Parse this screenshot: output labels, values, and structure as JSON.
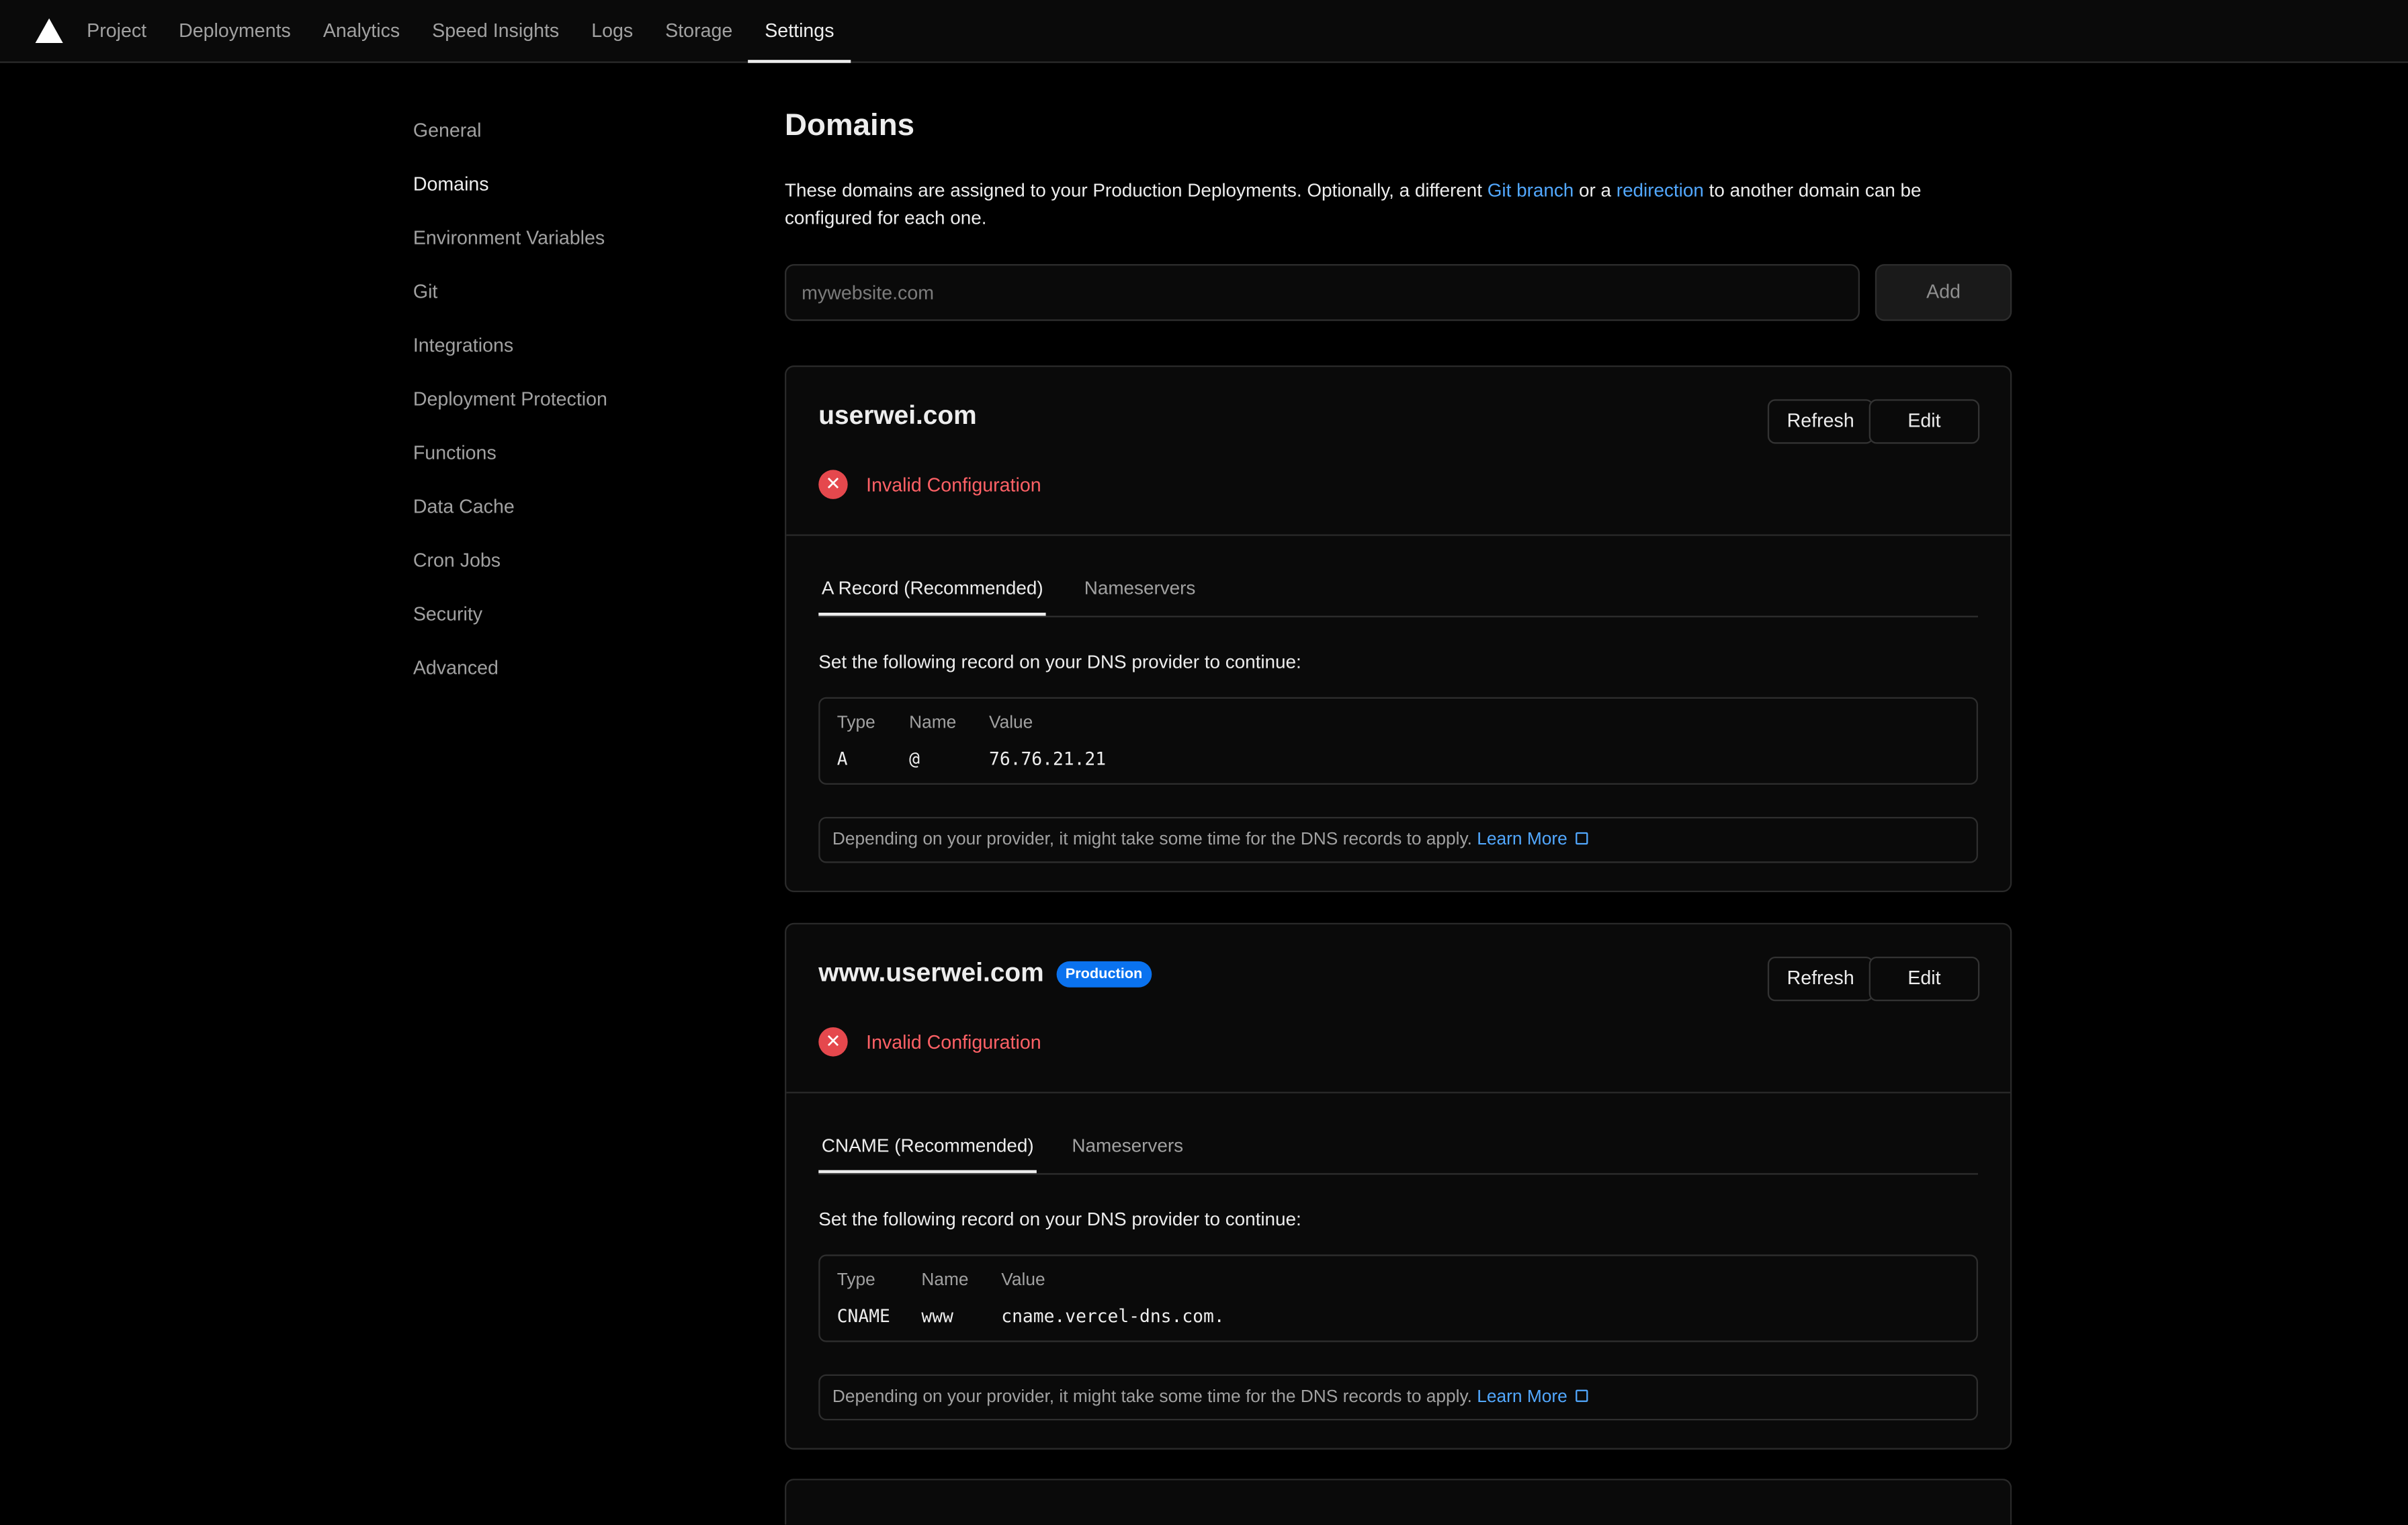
{
  "nav": {
    "tabs": [
      "Project",
      "Deployments",
      "Analytics",
      "Speed Insights",
      "Logs",
      "Storage",
      "Settings"
    ],
    "active": "Settings"
  },
  "sidebar": {
    "items": [
      "General",
      "Domains",
      "Environment Variables",
      "Git",
      "Integrations",
      "Deployment Protection",
      "Functions",
      "Data Cache",
      "Cron Jobs",
      "Security",
      "Advanced"
    ],
    "active": "Domains"
  },
  "main": {
    "title": "Domains",
    "description": {
      "part1": "These domains are assigned to your Production Deployments. Optionally, a different ",
      "link1": "Git branch",
      "part2": " or a ",
      "link2": "redirection",
      "part3": " to another domain can be configured for each one."
    },
    "input_placeholder": "mywebsite.com",
    "add_label": "Add"
  },
  "domains": [
    {
      "name": "userwei.com",
      "badge": "",
      "refresh_label": "Refresh",
      "edit_label": "Edit",
      "status": "Invalid Configuration",
      "tabs": [
        "A Record (Recommended)",
        "Nameservers"
      ],
      "instruction": "Set the following record on your DNS provider to continue:",
      "headers": [
        "Type",
        "Name",
        "Value"
      ],
      "record": [
        "A",
        "@",
        "76.76.21.21"
      ],
      "note": "Depending on your provider, it might take some time for the DNS records to apply.",
      "learn_more": "Learn More"
    },
    {
      "name": "www.userwei.com",
      "badge": "Production",
      "refresh_label": "Refresh",
      "edit_label": "Edit",
      "status": "Invalid Configuration",
      "tabs": [
        "CNAME (Recommended)",
        "Nameservers"
      ],
      "instruction": "Set the following record on your DNS provider to continue:",
      "headers": [
        "Type",
        "Name",
        "Value"
      ],
      "record": [
        "CNAME",
        "www",
        "cname.vercel-dns.com."
      ],
      "note": "Depending on your provider, it might take some time for the DNS records to apply.",
      "learn_more": "Learn More"
    }
  ],
  "colors": {
    "accent_link": "#52a8ff",
    "error": "#e5484d",
    "badge": "#0a72ef"
  }
}
